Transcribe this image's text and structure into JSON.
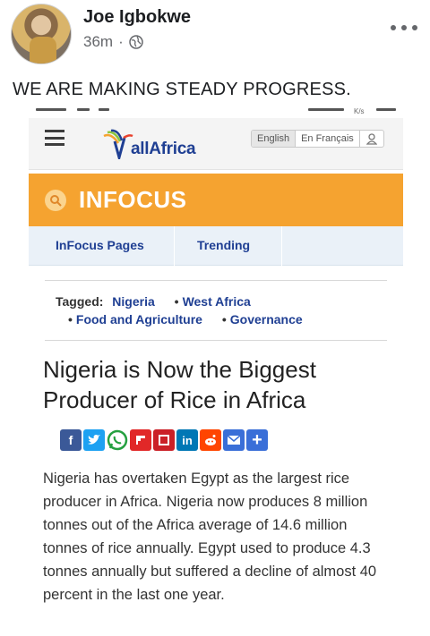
{
  "post": {
    "author": "Joe Igbokwe",
    "time": "36m",
    "separator": "·",
    "privacy_icon": "globe-icon",
    "text": "WE ARE MAKING STEADY PROGRESS."
  },
  "screenshot": {
    "status_bar_fragment": "K/s",
    "site": {
      "logo_text": "allAfrica",
      "lang_english": "English",
      "lang_french": "En Français",
      "user_icon": "user-icon"
    },
    "section": {
      "title": "INFOCUS",
      "icon": "search-icon"
    },
    "subnav": [
      "InFocus Pages",
      "Trending"
    ],
    "tags": {
      "label": "Tagged:",
      "items": [
        "Nigeria",
        "West Africa",
        "Food and Agriculture",
        "Governance"
      ]
    },
    "headline": "Nigeria is Now the Biggest Producer of Rice in Africa",
    "share_buttons": [
      "facebook",
      "twitter",
      "whatsapp",
      "flipboard",
      "pinterest",
      "linkedin",
      "reddit",
      "email",
      "more"
    ],
    "share_colors": {
      "facebook": "#3b5998",
      "twitter": "#1da1f2",
      "whatsapp": "#25d366",
      "flipboard": "#e12828",
      "pinterest": "#cb2027",
      "linkedin": "#0077b5",
      "reddit": "#ff4500",
      "email": "#3a6fd8",
      "more": "#3a6fd8"
    },
    "body": "Nigeria has overtaken Egypt as the largest rice producer in Africa.  Nigeria now produces 8 million tonnes out of the Africa average of 14.6 million tonnes of rice annually. Egypt used to produce 4.3 tonnes annually but suffered a decline of almost 40 percent in the last one year."
  },
  "colors": {
    "brand_blue": "#1f3f93",
    "infocus_orange": "#f5a330",
    "subnav_bg": "#eaf1f8"
  }
}
